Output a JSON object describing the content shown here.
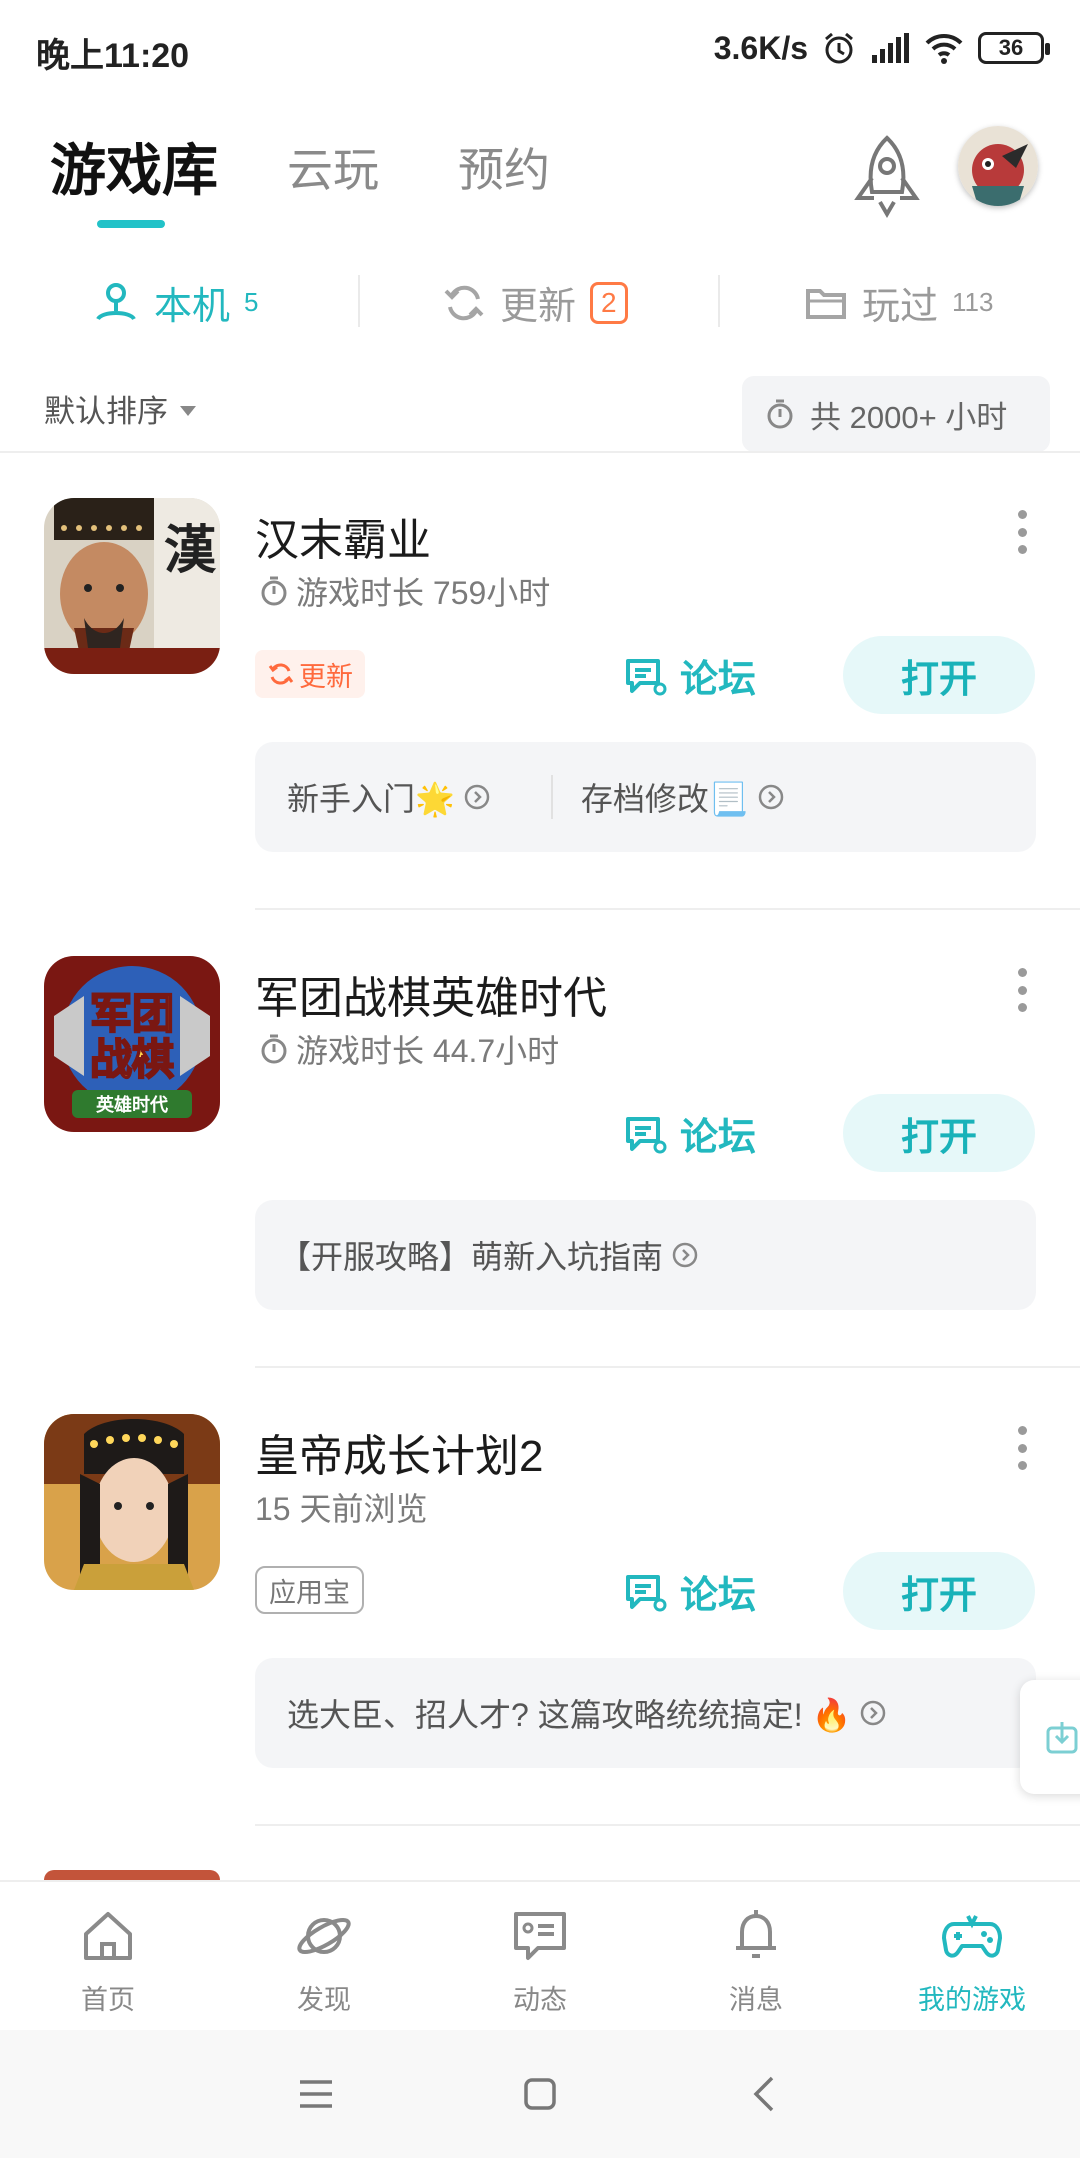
{
  "status_bar": {
    "time": "晚上11:20",
    "speed": "3.6K/s",
    "battery": "36"
  },
  "header": {
    "tabs": [
      {
        "label": "游戏库",
        "active": true
      },
      {
        "label": "云玩",
        "active": false
      },
      {
        "label": "预约",
        "active": false
      }
    ],
    "accent_color": "#22c2c8"
  },
  "segments": {
    "local": {
      "label": "本机",
      "count": "5"
    },
    "update": {
      "label": "更新",
      "count": "2"
    },
    "played": {
      "label": "玩过",
      "count": "113"
    }
  },
  "sort": {
    "label": "默认排序",
    "total_time": "共 2000+ 小时"
  },
  "games": [
    {
      "name": "汉末霸业",
      "meta": "游戏时长 759小时",
      "tag": "更新",
      "forum_label": "论坛",
      "open_label": "打开",
      "tips": [
        "新手入门🌟",
        "存档修改📃"
      ]
    },
    {
      "name": "军团战棋英雄时代",
      "meta": "游戏时长 44.7小时",
      "forum_label": "论坛",
      "open_label": "打开",
      "tips": [
        "【开服攻略】萌新入坑指南"
      ],
      "icon_text": [
        "军团",
        "战棋",
        "英雄时代"
      ]
    },
    {
      "name": "皇帝成长计划2",
      "meta": "15 天前浏览",
      "tag": "应用宝",
      "forum_label": "论坛",
      "open_label": "打开",
      "tips": [
        "选大臣、招人才? 这篇攻略统统搞定! 🔥"
      ]
    }
  ],
  "bottom_nav": [
    {
      "label": "首页",
      "icon": "home-icon"
    },
    {
      "label": "发现",
      "icon": "planet-icon"
    },
    {
      "label": "动态",
      "icon": "message-card-icon"
    },
    {
      "label": "消息",
      "icon": "bell-icon"
    },
    {
      "label": "我的游戏",
      "icon": "gamepad-icon",
      "active": true
    }
  ]
}
